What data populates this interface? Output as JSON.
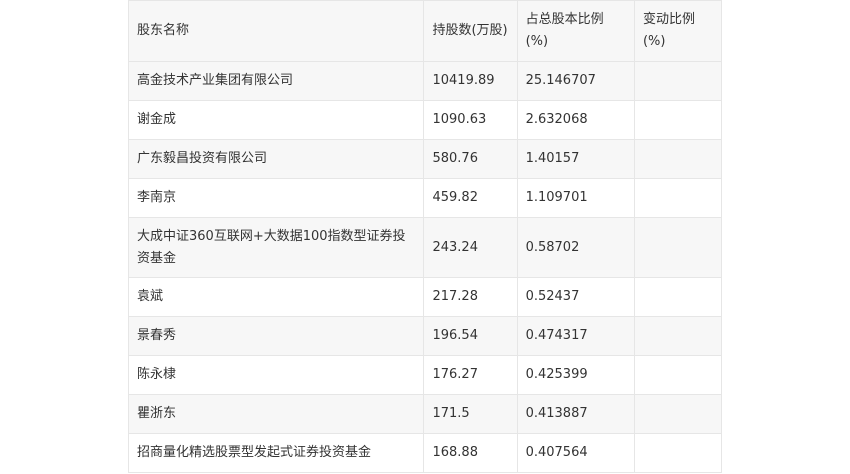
{
  "table": {
    "headers": [
      "股东名称",
      "持股数(万股)",
      "占总股本比例(%)",
      "变动比例(%)"
    ],
    "rows": [
      {
        "name": "高金技术产业集团有限公司",
        "shares": "10419.89",
        "ratio": "25.146707",
        "change": ""
      },
      {
        "name": "谢金成",
        "shares": "1090.63",
        "ratio": "2.632068",
        "change": ""
      },
      {
        "name": "广东毅昌投资有限公司",
        "shares": "580.76",
        "ratio": "1.40157",
        "change": ""
      },
      {
        "name": "李南京",
        "shares": "459.82",
        "ratio": "1.109701",
        "change": ""
      },
      {
        "name": "大成中证360互联网+大数据100指数型证券投资基金",
        "shares": "243.24",
        "ratio": "0.58702",
        "change": ""
      },
      {
        "name": "袁斌",
        "shares": "217.28",
        "ratio": "0.52437",
        "change": ""
      },
      {
        "name": "景春秀",
        "shares": "196.54",
        "ratio": "0.474317",
        "change": ""
      },
      {
        "name": "陈永棣",
        "shares": "176.27",
        "ratio": "0.425399",
        "change": ""
      },
      {
        "name": "瞿浙东",
        "shares": "171.5",
        "ratio": "0.413887",
        "change": ""
      },
      {
        "name": "招商量化精选股票型发起式证券投资基金",
        "shares": "168.88",
        "ratio": "0.407564",
        "change": ""
      }
    ]
  }
}
